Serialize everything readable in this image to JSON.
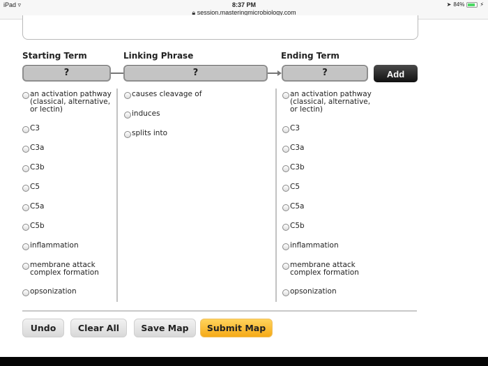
{
  "statusbar": {
    "device": "iPad",
    "wifi_icon": "wifi-icon",
    "time": "8:37 PM",
    "url": "session.masteringmicrobiology.com",
    "lock_icon": "lock-icon",
    "battery_percent": "84%",
    "battery_level": 0.84,
    "location_icon": "location-arrow-icon",
    "charging_icon": "bolt-icon"
  },
  "builder": {
    "starting_term_label": "Starting Term",
    "linking_phrase_label": "Linking Phrase",
    "ending_term_label": "Ending Term",
    "starting_slot": "?",
    "linking_slot": "?",
    "ending_slot": "?",
    "add_label": "Add"
  },
  "starting_terms": [
    "an activation pathway (classical, alternative, or lectin)",
    "C3",
    "C3a",
    "C3b",
    "C5",
    "C5a",
    "C5b",
    "inflammation",
    "membrane attack complex formation",
    "opsonization"
  ],
  "linking_phrases": [
    "causes cleavage of",
    "induces",
    "splits into"
  ],
  "ending_terms": [
    "an activation pathway (classical, alternative, or lectin)",
    "C3",
    "C3a",
    "C3b",
    "C5",
    "C5a",
    "C5b",
    "inflammation",
    "membrane attack complex formation",
    "opsonization"
  ],
  "actions": {
    "undo": "Undo",
    "clear_all": "Clear All",
    "save_map": "Save Map",
    "submit_map": "Submit Map"
  },
  "colors": {
    "submit": "#f5aa17",
    "add_button": "#111111",
    "slot": "#c4c4c4"
  }
}
